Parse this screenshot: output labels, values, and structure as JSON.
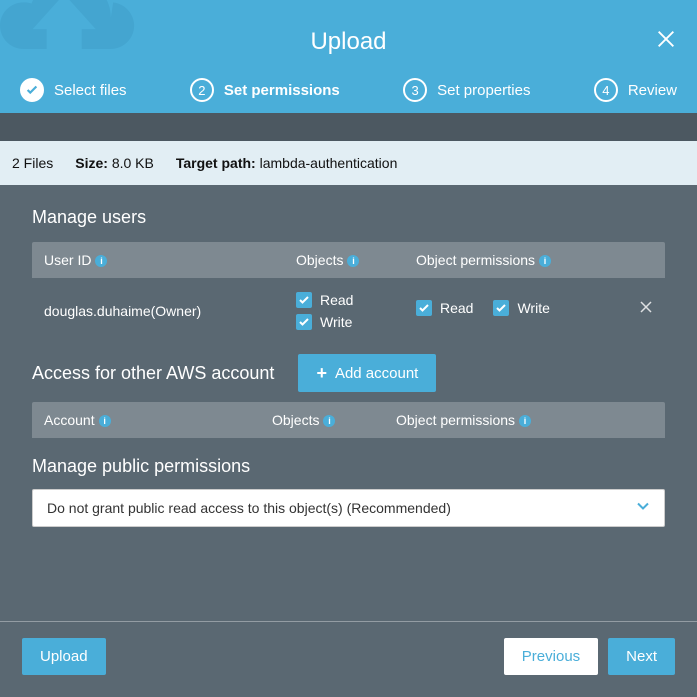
{
  "header": {
    "title": "Upload",
    "steps": [
      {
        "label": "Select files",
        "state": "done"
      },
      {
        "num": "2",
        "label": "Set permissions",
        "state": "current"
      },
      {
        "num": "3",
        "label": "Set properties",
        "state": "pending"
      },
      {
        "num": "4",
        "label": "Review",
        "state": "pending"
      }
    ]
  },
  "info": {
    "files_count": "2 Files",
    "size_label": "Size:",
    "size_value": "8.0 KB",
    "target_label": "Target path:",
    "target_value": "lambda-authentication"
  },
  "manage_users": {
    "title": "Manage users",
    "columns": {
      "user": "User ID",
      "objects": "Objects",
      "perms": "Object permissions"
    },
    "rows": [
      {
        "user": "douglas.duhaime(Owner)",
        "objects": [
          {
            "label": "Read",
            "checked": true
          },
          {
            "label": "Write",
            "checked": true
          }
        ],
        "perms": [
          {
            "label": "Read",
            "checked": true
          },
          {
            "label": "Write",
            "checked": true
          }
        ]
      }
    ]
  },
  "other_access": {
    "title": "Access for other AWS account",
    "add_label": "Add account",
    "columns": {
      "account": "Account",
      "objects": "Objects",
      "perms": "Object permissions"
    }
  },
  "public": {
    "title": "Manage public permissions",
    "selected": "Do not grant public read access to this object(s) (Recommended)",
    "options": [
      "Do not grant public read access to this object(s) (Recommended)"
    ]
  },
  "footer": {
    "upload": "Upload",
    "previous": "Previous",
    "next": "Next"
  }
}
